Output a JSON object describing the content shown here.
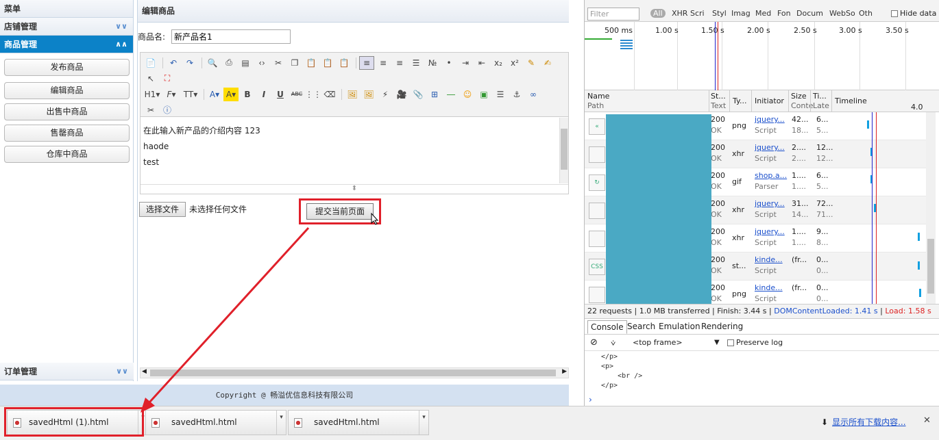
{
  "sidebar": {
    "menu_title": "菜单",
    "store_mgmt": "店铺管理",
    "product_mgmt": "商品管理",
    "items": [
      "发布商品",
      "编辑商品",
      "出售中商品",
      "售罄商品",
      "仓库中商品"
    ],
    "order_mgmt": "订单管理"
  },
  "main": {
    "title": "编辑商品",
    "name_label": "商品名:",
    "name_value": "新产品名1",
    "content_lines": [
      "在此输入新产品的介绍内容 123",
      "haode",
      "test"
    ],
    "choose_file": "选择文件",
    "no_file": "未选择任何文件",
    "submit": "提交当前页面"
  },
  "footer": "Copyright @ 畅溢优信息科技有限公司",
  "devtools": {
    "filter_placeholder": "Filter",
    "types": [
      "All",
      "XHR",
      "Scri",
      "Styl",
      "Imag",
      "Med",
      "Fon",
      "Docum",
      "WebSo",
      "Oth"
    ],
    "hide_data": "Hide data",
    "ticks": [
      "500 ms",
      "1.00 s",
      "1.50 s",
      "2.00 s",
      "2.50 s",
      "3.00 s",
      "3.50 s"
    ],
    "headers": {
      "name": "Name",
      "path": "Path",
      "status": "St...",
      "status_sub": "Text",
      "type": "Ty...",
      "initiator": "Initiator",
      "size": "Size",
      "size_sub": "Conte",
      "time": "Ti...",
      "time_sub": "Late",
      "timeline": "Timeline",
      "timeline_tick": "4.0"
    },
    "rows": [
      {
        "status": "200",
        "text": "OK",
        "type": "png",
        "init": "jquery...",
        "init_sub": "Script",
        "size": "42...",
        "size_sub": "18...",
        "time": "6...",
        "time_sub": "5..."
      },
      {
        "status": "200",
        "text": "OK",
        "type": "xhr",
        "init": "jquery...",
        "init_sub": "Script",
        "size": "2....",
        "size_sub": "2....",
        "time": "12...",
        "time_sub": "12..."
      },
      {
        "status": "200",
        "text": "OK",
        "type": "gif",
        "init": "shop.a...",
        "init_sub": "Parser",
        "size": "1....",
        "size_sub": "1....",
        "time": "6...",
        "time_sub": "5..."
      },
      {
        "status": "200",
        "text": "OK",
        "type": "xhr",
        "init": "jquery...",
        "init_sub": "Script",
        "size": "31...",
        "size_sub": "14...",
        "time": "72...",
        "time_sub": "71..."
      },
      {
        "status": "200",
        "text": "OK",
        "type": "xhr",
        "init": "jquery...",
        "init_sub": "Script",
        "size": "1....",
        "size_sub": "1....",
        "time": "9...",
        "time_sub": "8..."
      },
      {
        "status": "200",
        "text": "OK",
        "type": "st...",
        "init": "kinde...",
        "init_sub": "Script",
        "size": "(fr...",
        "size_sub": "",
        "time": "0...",
        "time_sub": "0..."
      },
      {
        "status": "200",
        "text": "OK",
        "type": "png",
        "init": "kinde...",
        "init_sub": "Script",
        "size": "(fr...",
        "size_sub": "",
        "time": "0...",
        "time_sub": "0..."
      }
    ],
    "status_bar": {
      "requests": "22 requests",
      "transferred": "1.0 MB transferred",
      "finish": "Finish: 3.44 s",
      "dcl": "DOMContentLoaded: 1.41 s",
      "load": "Load: 1.58 s"
    },
    "tabs": [
      "Console",
      "Search",
      "Emulation",
      "Rendering"
    ],
    "frame": "<top frame>",
    "preserve_log": "Preserve log",
    "console_lines": [
      "</p>",
      "<p>",
      "    <br />",
      "</p>"
    ]
  },
  "downloads": {
    "files": [
      "savedHtml (1).html",
      "savedHtml.html",
      "savedHtml.html"
    ],
    "show_all": "显示所有下载内容..."
  },
  "colors": {
    "accent_blue": "#0c82c8",
    "highlight_red": "#e0202a",
    "redaction": "#4aa9c4",
    "footer_bg": "#d4e1f1"
  }
}
